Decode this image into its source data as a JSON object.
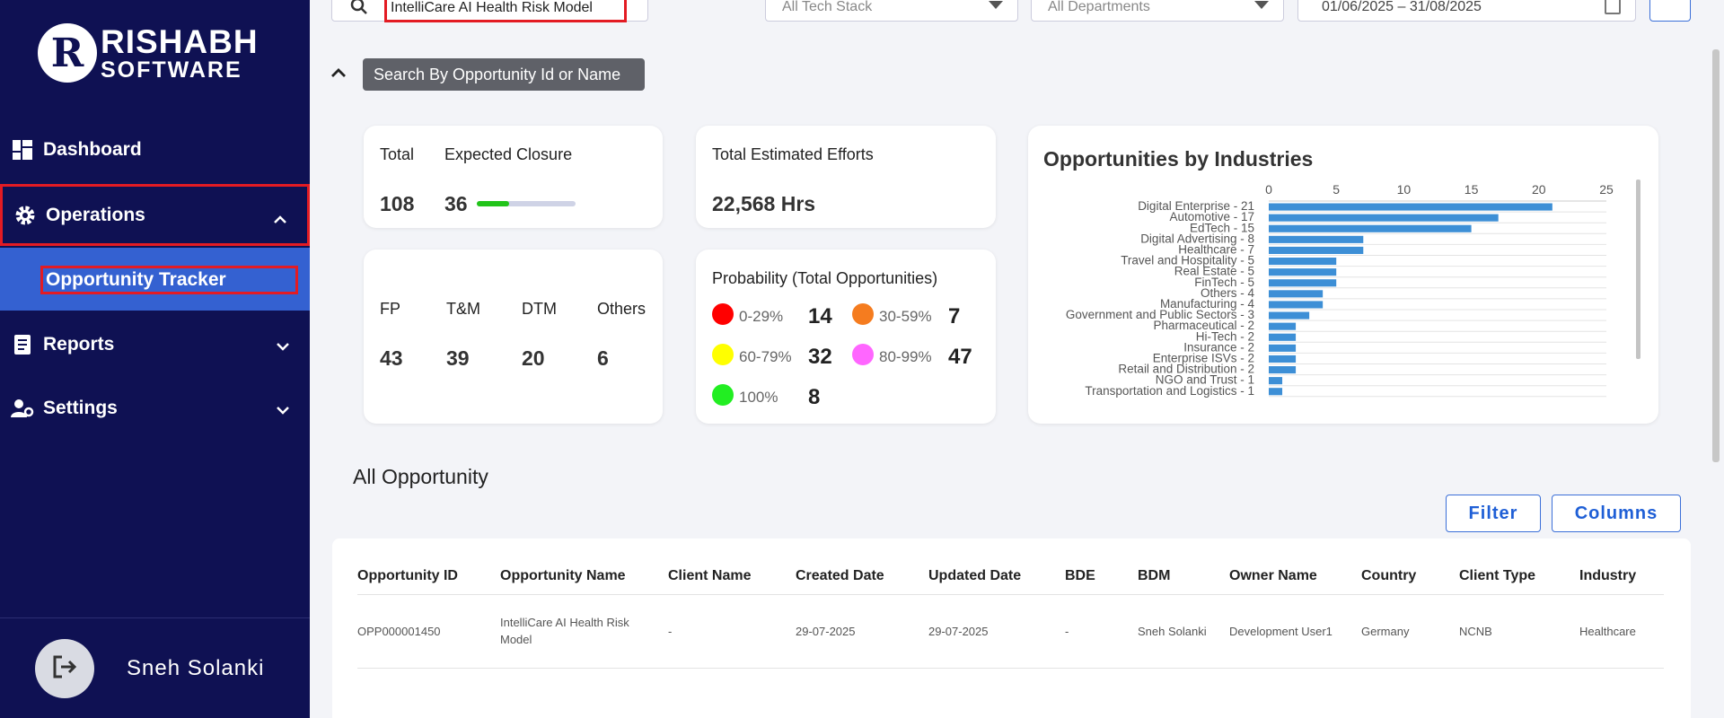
{
  "sidebar": {
    "logo": {
      "mark": "R",
      "line1": "RISHABH",
      "line2": "SOFTWARE"
    },
    "items": [
      {
        "label": "Dashboard",
        "icon": "dashboard-grid-icon"
      },
      {
        "label": "Operations",
        "icon": "gear-icon"
      },
      {
        "label": "Opportunity Tracker"
      },
      {
        "label": "Reports",
        "icon": "report-icon"
      },
      {
        "label": "Settings",
        "icon": "user-gear-icon"
      }
    ],
    "user_name": "Sneh Solanki"
  },
  "topbar": {
    "search_value": "IntelliCare AI Health Risk Model",
    "tech_stack": "All Tech Stack",
    "departments": "All Departments",
    "date_range": "01/06/2025   –  31/08/2025"
  },
  "search_chip": "Search By Opportunity Id or Name",
  "summary": {
    "total_label": "Total",
    "total_value": "108",
    "expected_label": "Expected Closure",
    "expected_value": "36",
    "expected_progress": 0.33,
    "efforts_label": "Total Estimated Efforts",
    "efforts_value": "22,568 Hrs",
    "types": [
      {
        "label": "FP",
        "value": "43"
      },
      {
        "label": "T&M",
        "value": "39"
      },
      {
        "label": "DTM",
        "value": "20"
      },
      {
        "label": "Others",
        "value": "6"
      }
    ]
  },
  "probability": {
    "title": "Probability (Total Opportunities)",
    "items": [
      {
        "range": "0-29%",
        "value": "14",
        "color": "#ff0000"
      },
      {
        "range": "30-59%",
        "value": "7",
        "color": "#f57c1f"
      },
      {
        "range": "60-79%",
        "value": "32",
        "color": "#ffff00"
      },
      {
        "range": "80-99%",
        "value": "47",
        "color": "#ff66ff"
      },
      {
        "range": "100%",
        "value": "8",
        "color": "#22ee22"
      }
    ]
  },
  "chart_data": {
    "type": "bar",
    "orientation": "horizontal",
    "title": "Opportunities by Industries",
    "categories": [
      "Digital Enterprise - 21",
      "Automotive - 17",
      "EdTech - 15",
      "Digital Advertising - 8",
      "Healthcare - 7",
      "Travel and Hospitality - 5",
      "Real Estate - 5",
      "FinTech - 5",
      "Others - 4",
      "Manufacturing - 4",
      "Government and Public Sectors - 3",
      "Pharmaceutical - 2",
      "Hi-Tech - 2",
      "Insurance - 2",
      "Enterprise ISVs - 2",
      "Retail and Distribution - 2",
      "NGO and Trust - 1",
      "Transportation and Logistics - 1"
    ],
    "values": [
      21,
      17,
      15,
      7,
      7,
      5,
      5,
      5,
      4,
      4,
      3,
      2,
      2,
      2,
      2,
      2,
      1,
      1
    ],
    "xticks": [
      "0",
      "5",
      "10",
      "15",
      "20",
      "25"
    ],
    "xlim": [
      0,
      25
    ],
    "axis_position": "top",
    "grid": true,
    "bar_color": "#3d8fd6"
  },
  "table": {
    "section_title": "All Opportunity",
    "filter_label": "Filter",
    "columns_label": "Columns",
    "headers": [
      "Opportunity ID",
      "Opportunity Name",
      "Client Name",
      "Created Date",
      "Updated Date",
      "BDE",
      "BDM",
      "Owner Name",
      "Country",
      "Client Type",
      "Industry"
    ],
    "rows": [
      [
        "OPP000001450",
        "IntelliCare AI Health Risk Model",
        "-",
        "29-07-2025",
        "29-07-2025",
        "-",
        "Sneh Solanki",
        "Development User1",
        "Germany",
        "NCNB",
        "Healthcare"
      ]
    ]
  }
}
